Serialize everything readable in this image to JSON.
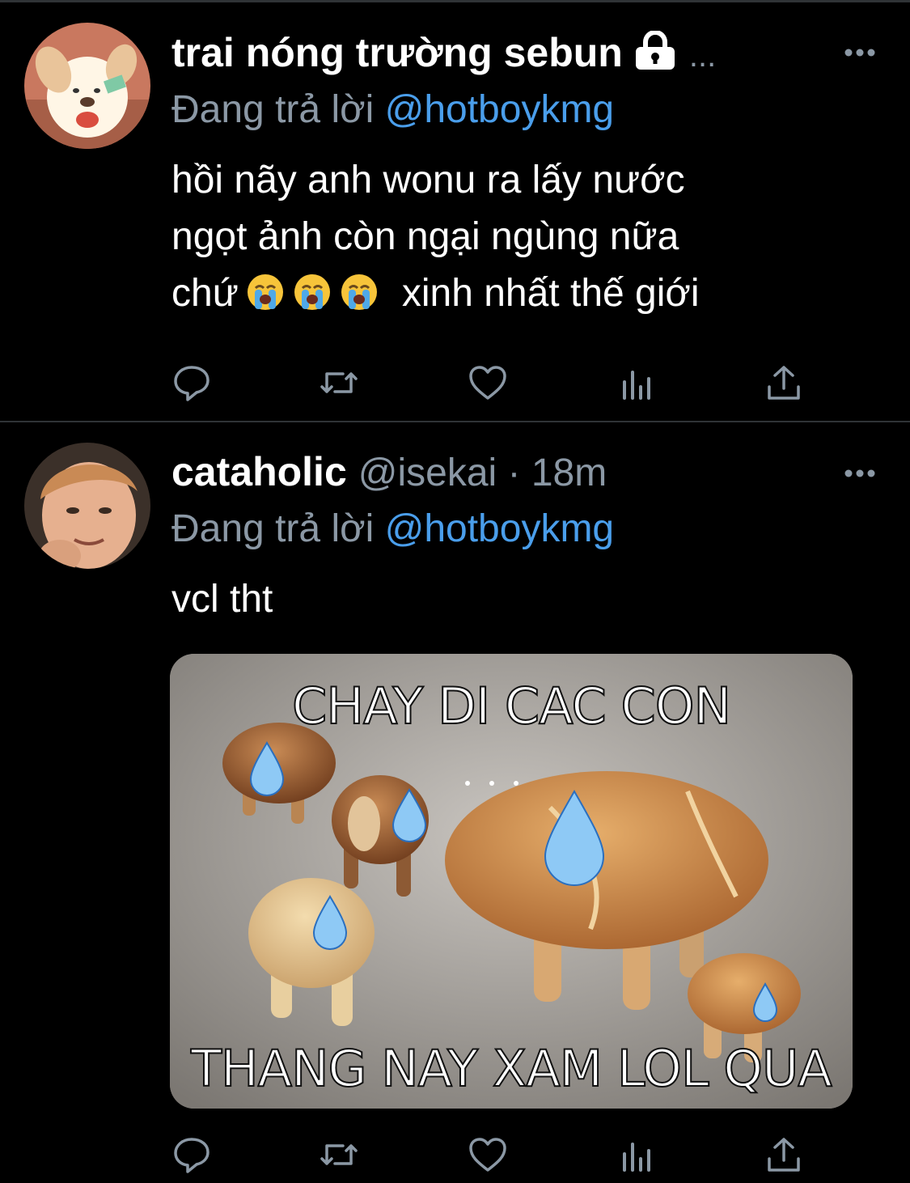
{
  "tweets": [
    {
      "display_name": "trai nóng trường sebun",
      "truncation": "...",
      "reply_label": "Đang trả lời",
      "reply_to": "@hotboykmg",
      "text_line1": "hồi nãy anh wonu ra lấy nước",
      "text_line2": "ngọt ảnh còn ngại ngùng nữa",
      "text_line3a": "chứ",
      "text_line3b": "xinh nhất thế giới"
    },
    {
      "display_name": "cataholic",
      "handle": "@isekai · 18m",
      "reply_label": "Đang trả lời",
      "reply_to": "@hotboykmg",
      "text": "vcl tht",
      "media": {
        "caption_top": "CHAY DI CAC CON",
        "caption_bottom": "THANG NAY XAM LOL QUA"
      }
    }
  ],
  "colors": {
    "background": "#000000",
    "muted": "#8b98a5",
    "link": "#4a9eeb",
    "divider": "#2f3336"
  },
  "icons": [
    "lock-icon",
    "more-icon",
    "reply-icon",
    "retweet-icon",
    "like-icon",
    "analytics-icon",
    "share-icon",
    "loudly-crying-emoji"
  ]
}
